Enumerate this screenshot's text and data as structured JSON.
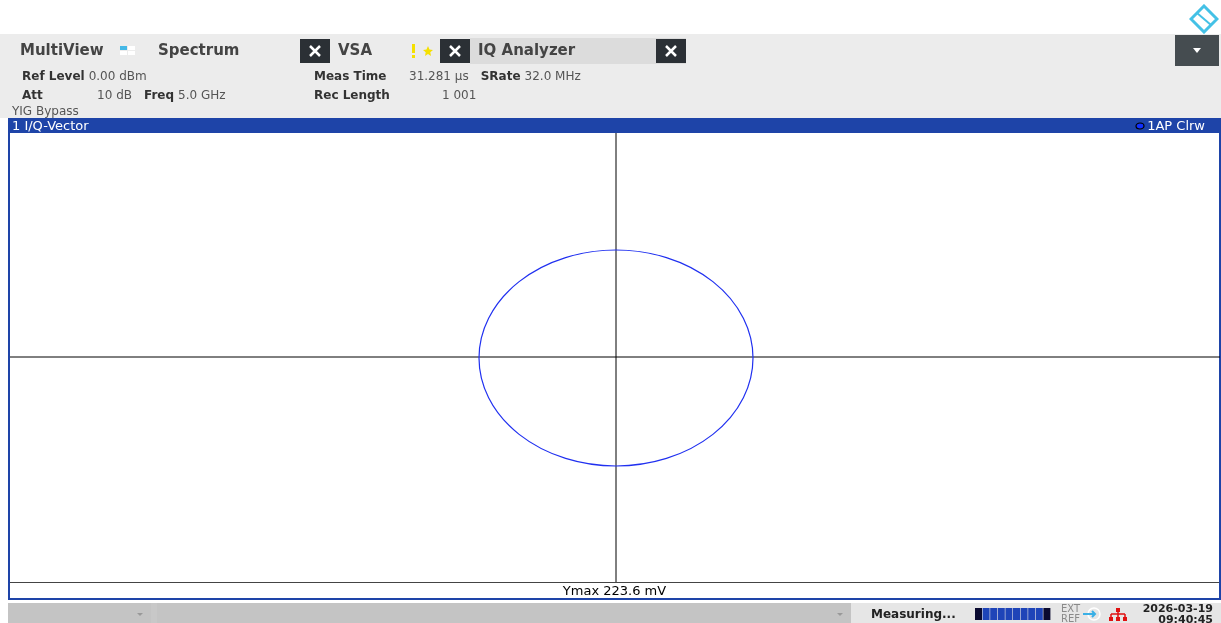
{
  "tabs": [
    {
      "label": "MultiView",
      "kind": "multiview",
      "selected": false
    },
    {
      "label": "Spectrum",
      "kind": "channel",
      "selected": false,
      "warning": false
    },
    {
      "label": "VSA",
      "kind": "channel",
      "selected": false,
      "warning": true
    },
    {
      "label": "IQ Analyzer",
      "kind": "channel",
      "selected": true,
      "warning": false
    }
  ],
  "settings": {
    "ref_level_label": "Ref Level",
    "ref_level": "0.00 dBm",
    "att_label": "Att",
    "att": "10 dB",
    "freq_label": "Freq",
    "freq": "5.0 GHz",
    "meas_time_label": "Meas Time",
    "meas_time": "31.281 µs",
    "srate_label": "SRate",
    "srate": "32.0 MHz",
    "rec_length_label": "Rec Length",
    "rec_length": "1 001",
    "note": "YIG Bypass"
  },
  "window": {
    "title": "1 I/Q-Vector",
    "trace": "1AP Clrw",
    "footer": "Ymax 223.6 mV"
  },
  "status_bar": {
    "status": "Measuring...",
    "ext_ref": {
      "label_1": "EXT",
      "label_2": "REF",
      "active": false
    },
    "date": "2026-03-19",
    "time": "09:40:45"
  }
}
